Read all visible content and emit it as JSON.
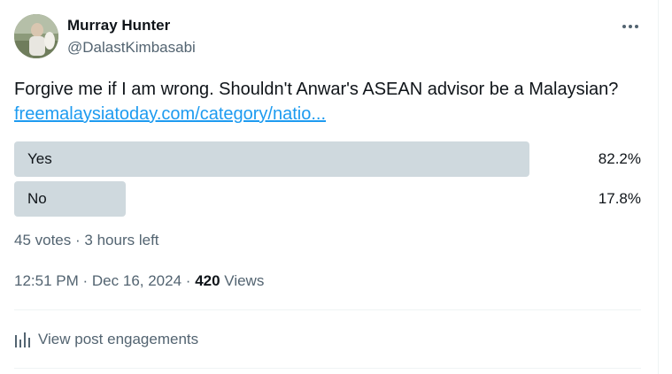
{
  "author": {
    "name": "Murray Hunter",
    "handle": "@DalastKimbasabi"
  },
  "tweet": {
    "text": "Forgive me if I am wrong. Shouldn't Anwar's ASEAN advisor be a Malaysian? ",
    "link_text": "freemalaysiatoday.com/category/natio..."
  },
  "poll": {
    "options": [
      {
        "label": "Yes",
        "percent_text": "82.2%",
        "percent": 82.2
      },
      {
        "label": "No",
        "percent_text": "17.8%",
        "percent": 17.8
      }
    ],
    "votes_text": "45 votes",
    "separator": "·",
    "time_left": "3 hours left"
  },
  "footer": {
    "time": "12:51 PM",
    "separator": "·",
    "date": "Dec 16, 2024",
    "views_count": "420",
    "views_label": "Views",
    "engagements_label": "View post engagements"
  },
  "colors": {
    "link": "#1d9bf0",
    "bar": "#cfd9de",
    "secondary_text": "#536471",
    "primary_text": "#0f1419"
  },
  "icons": {
    "more": "more-horizontal-icon",
    "engagements": "bar-chart-icon"
  }
}
